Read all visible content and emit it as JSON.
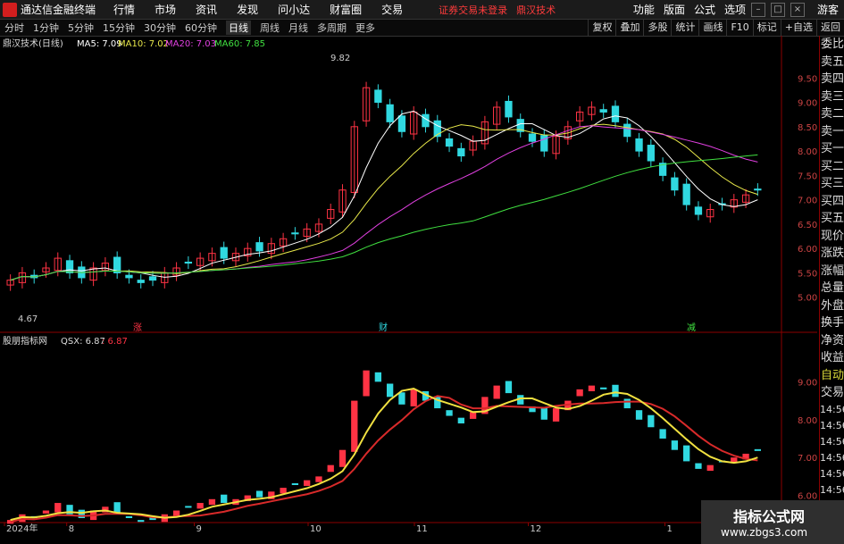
{
  "app": {
    "title": "通达信金融终端",
    "menu": [
      "行情",
      "市场",
      "资讯",
      "发现",
      "问小达",
      "财富圈",
      "交易"
    ],
    "notice": "证券交易未登录",
    "notice2": "鼎汉技术",
    "right_menu": [
      "功能",
      "版面",
      "公式",
      "选项"
    ],
    "user": "游客"
  },
  "toolbar": {
    "periods": [
      "分时",
      "1分钟",
      "5分钟",
      "15分钟",
      "30分钟",
      "60分钟",
      "日线",
      "周线",
      "月线",
      "多周期",
      "更多"
    ],
    "active": "日线",
    "right_buttons": [
      "复权",
      "叠加",
      "多股",
      "统计",
      "画线",
      "F10",
      "标记",
      "+自选",
      "返回"
    ]
  },
  "main_chart": {
    "legend_name": "鼎汉技术(日线)",
    "legend": [
      {
        "label": "MA5: 7.09",
        "color": "#ffffff"
      },
      {
        "label": "MA10: 7.02",
        "color": "#e8e84a"
      },
      {
        "label": "MA20: 7.03",
        "color": "#e040e0"
      },
      {
        "label": "MA60: 7.85",
        "color": "#40e040"
      }
    ],
    "max_label": "9.82",
    "min_label": "4.67",
    "marks": [
      "涨",
      "财",
      "减"
    ]
  },
  "indicator_chart": {
    "legend_name": "股朋指标网",
    "legend_value": "QSX: 6.87",
    "legend_value2": ": 6.87"
  },
  "side_panel": {
    "items": [
      "委比",
      "卖五",
      "卖四",
      "卖三",
      "卖二",
      "卖一",
      "买一",
      "买二",
      "买三",
      "买四",
      "买五",
      "现价",
      "涨跌",
      "涨幅",
      "总量",
      "外盘",
      "换手",
      "净资",
      "收益"
    ],
    "auto": [
      "自动",
      "交易"
    ],
    "times": [
      "14:56",
      "14:56",
      "14:56",
      "14:56",
      "14:56",
      "14:56",
      "14:56",
      "14:56"
    ]
  },
  "watermark": {
    "title": "指标公式网",
    "url": "www.zbgs3.com"
  },
  "colors": {
    "up": "#ff3344",
    "down": "#30d8e0",
    "ma5": "#ffffff",
    "ma10": "#e8e84a",
    "ma20": "#e040e0",
    "ma60": "#40e040",
    "border": "#8b0000"
  },
  "chart_data": [
    {
      "type": "candlestick",
      "title": "鼎汉技术(日线)",
      "y_ticks": [
        5.0,
        5.5,
        6.0,
        6.5,
        7.0,
        7.5,
        8.0,
        8.5,
        9.0,
        9.5
      ],
      "ylim": [
        4.5,
        10.0
      ],
      "x_months": [
        "2024年",
        "8",
        "9",
        "10",
        "11",
        "12",
        "1"
      ],
      "close_series": [
        5.35,
        5.5,
        5.4,
        5.6,
        5.8,
        5.5,
        5.4,
        5.6,
        5.7,
        5.5,
        5.4,
        5.3,
        5.35,
        5.5,
        5.6,
        5.7,
        5.8,
        5.9,
        5.8,
        5.9,
        6.0,
        5.95,
        6.1,
        6.2,
        6.3,
        6.4,
        6.5,
        6.8,
        7.2,
        8.5,
        9.3,
        9.0,
        8.6,
        8.4,
        8.8,
        8.5,
        8.3,
        8.1,
        7.9,
        8.2,
        8.6,
        8.9,
        8.7,
        8.4,
        8.2,
        8.0,
        8.3,
        8.5,
        8.8,
        8.9,
        8.8,
        8.6,
        8.3,
        8.0,
        7.8,
        7.5,
        7.2,
        6.9,
        6.7,
        6.8,
        6.9,
        7.0,
        7.1,
        7.2
      ],
      "ma_values": {
        "MA5": 7.09,
        "MA10": 7.02,
        "MA20": 7.03,
        "MA60": 7.85
      },
      "max": 9.82,
      "min": 4.67
    },
    {
      "type": "line",
      "title": "股朋指标网",
      "y_ticks": [
        6.0,
        7.0,
        8.0,
        9.0
      ],
      "ylim": [
        5.4,
        10.0
      ],
      "series": [
        {
          "name": "QSX",
          "last": 6.87
        }
      ]
    }
  ]
}
